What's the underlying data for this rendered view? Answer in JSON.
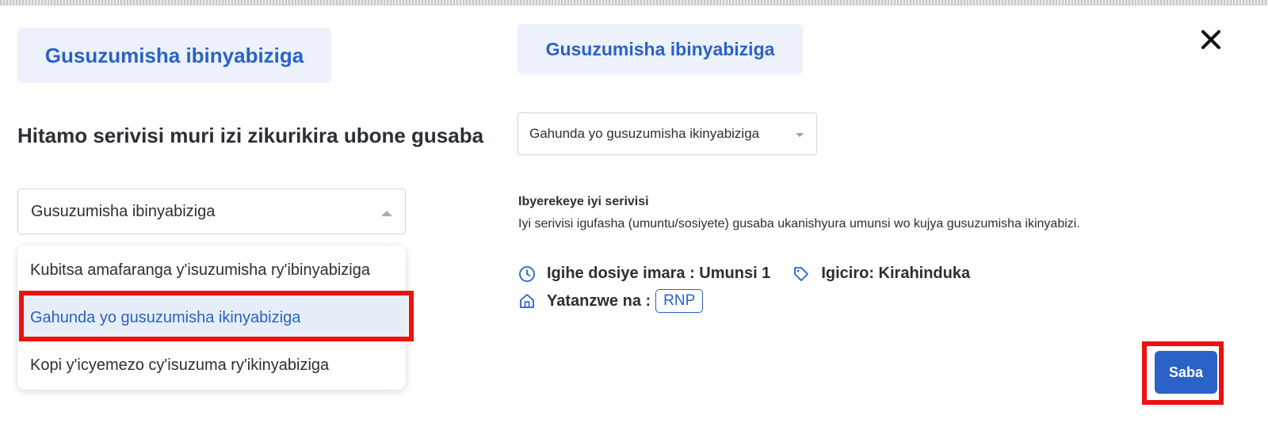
{
  "header": {
    "left_chip": "Gusuzumisha ibinyabiziga",
    "right_chip": "Gusuzumisha ibinyabiziga",
    "close_icon": "close-icon"
  },
  "left_panel": {
    "heading": "Hitamo serivisi muri izi zikurikira ubone gusaba",
    "select_value": "Gusuzumisha ibinyabiziga",
    "options": [
      "Kubitsa amafaranga y'isuzumisha ry'ibinyabiziga",
      "Gahunda yo gusuzumisha ikinyabiziga",
      "Kopi y'icyemezo cy'isuzuma ry'ikinyabiziga"
    ],
    "highlighted_option": "Gahunda yo gusuzumisha ikinyabiziga"
  },
  "right_panel": {
    "select_value": "Gahunda yo gusuzumisha ikinyabiziga",
    "about_title": "Ibyerekeye iyi serivisi",
    "about_text": "Iyi serivisi igufasha (umuntu/sosiyete) gusaba ukanishyura umunsi wo kujya gusuzumisha ikinyabizi.",
    "duration": "Igihe dosiye imara : Umunsi 1",
    "price": "Igiciro: Kirahinduka",
    "provider_label": "Yatanzwe na :",
    "provider": "RNP",
    "submit_label": "Saba"
  },
  "icons": {
    "duration": "clock-icon",
    "price": "tag-icon",
    "provider": "home-icon"
  },
  "colors": {
    "accent": "#2a62c8",
    "chip_bg": "#ecf1fb",
    "highlight": "#ee1111",
    "selected_option_bg": "#e6eef9"
  }
}
